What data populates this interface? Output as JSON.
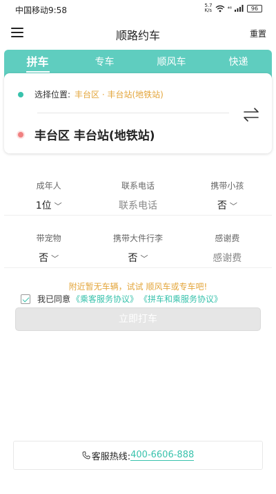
{
  "status_bar": {
    "carrier_time": "中国移动9:58",
    "net_speed_value": "5.7",
    "net_speed_unit": "K/s",
    "network": "⁴⁶",
    "battery": "96"
  },
  "nav": {
    "title": "顺路约车",
    "reset": "重置"
  },
  "tabs": [
    {
      "label": "拼车",
      "active": true
    },
    {
      "label": "专车",
      "active": false
    },
    {
      "label": "顺风车",
      "active": false
    },
    {
      "label": "快递",
      "active": false
    }
  ],
  "location": {
    "start_label": "选择位置:",
    "start_value": "丰台区 · 丰台站(地铁站)",
    "end_value": "丰台区 丰台站(地铁站)"
  },
  "form_row_1": [
    {
      "label": "成年人",
      "value": "1位",
      "dropdown": true
    },
    {
      "label": "联系电话",
      "placeholder": "联系电话"
    },
    {
      "label": "携带小孩",
      "value": "否",
      "dropdown": true
    }
  ],
  "form_row_2": [
    {
      "label": "带宠物",
      "value": "否",
      "dropdown": true
    },
    {
      "label": "携带大件行李",
      "value": "否",
      "dropdown": true
    },
    {
      "label": "感谢费",
      "placeholder": "感谢费"
    }
  ],
  "notice": "附近暂无车辆，试试 顺风车或专车吧!",
  "agreement": {
    "checked": true,
    "prefix": "我已同意",
    "link1": "《乘客服务协议》",
    "link2": "《拼车和乘服务协议》"
  },
  "submit_label": "立即打车",
  "hotline": {
    "label": "客服热线:",
    "number": "400-6606-888"
  },
  "colors": {
    "accent": "#5fcdbf",
    "link": "#38c2ac",
    "warning": "#e3a53a"
  }
}
